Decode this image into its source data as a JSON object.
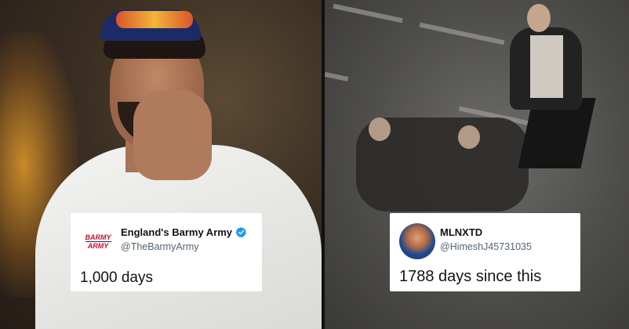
{
  "tweets": [
    {
      "display_name": "England's Barmy Army",
      "handle": "@TheBarmyArmy",
      "verified": true,
      "avatar_icon": "barmy-army-logo",
      "avatar_text": [
        "BARMY",
        "ARMY"
      ],
      "text": "1,000 days"
    },
    {
      "display_name": "MLNXTD",
      "handle": "@HimeshJ45731035",
      "verified": false,
      "avatar_icon": "profile-photo",
      "text": "1788 days since this"
    }
  ],
  "colors": {
    "verified_blue": "#1d9bf0",
    "tweet_text": "#0f1419",
    "handle_gray": "#536471",
    "barmy_red": "#c8102e"
  }
}
